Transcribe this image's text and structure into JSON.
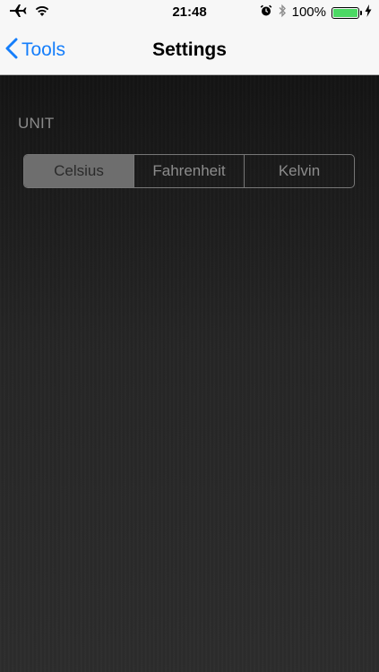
{
  "status_bar": {
    "time": "21:48",
    "battery_percent": "100%",
    "battery_level": 1.0,
    "icons": [
      "airplane-icon",
      "wifi-icon",
      "alarm-icon",
      "bluetooth-icon",
      "battery-icon",
      "charging-bolt-icon"
    ]
  },
  "nav": {
    "back_label": "Tools",
    "title": "Settings"
  },
  "settings": {
    "unit_header": "UNIT",
    "unit_options": [
      "Celsius",
      "Fahrenheit",
      "Kelvin"
    ],
    "selected_unit": "Celsius"
  },
  "colors": {
    "accent": "#157efb",
    "battery_fill": "#4cd964",
    "background": "#1b1b1b"
  }
}
